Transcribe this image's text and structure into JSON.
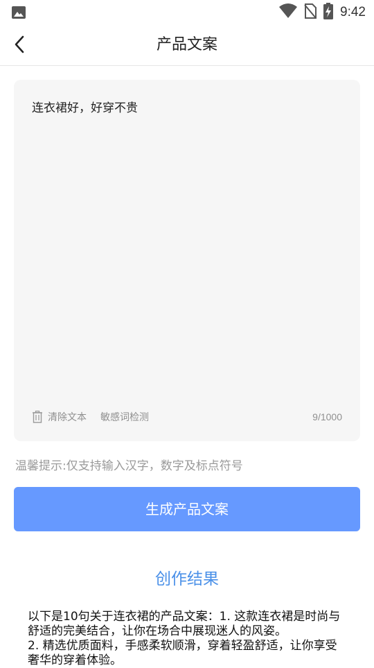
{
  "status_bar": {
    "time": "9:42"
  },
  "header": {
    "title": "产品文案"
  },
  "editor": {
    "text": "连衣裙好，好穿不贵",
    "clear_label": "清除文本",
    "sensitive_label": "敏感词检测",
    "counter": "9/1000"
  },
  "tip": "温馨提示:仅支持输入汉字，数字及标点符号",
  "generate_button": "生成产品文案",
  "result": {
    "title": "创作结果",
    "lines": [
      "以下是10句关于连衣裙的产品文案：1. 这款连衣裙是时尚与舒适的完美结合，让你在场合中展现迷人的风姿。",
      "2. 精选优质面料，手感柔软顺滑，穿着轻盈舒适，让你享受奢华的穿着体验。"
    ]
  }
}
